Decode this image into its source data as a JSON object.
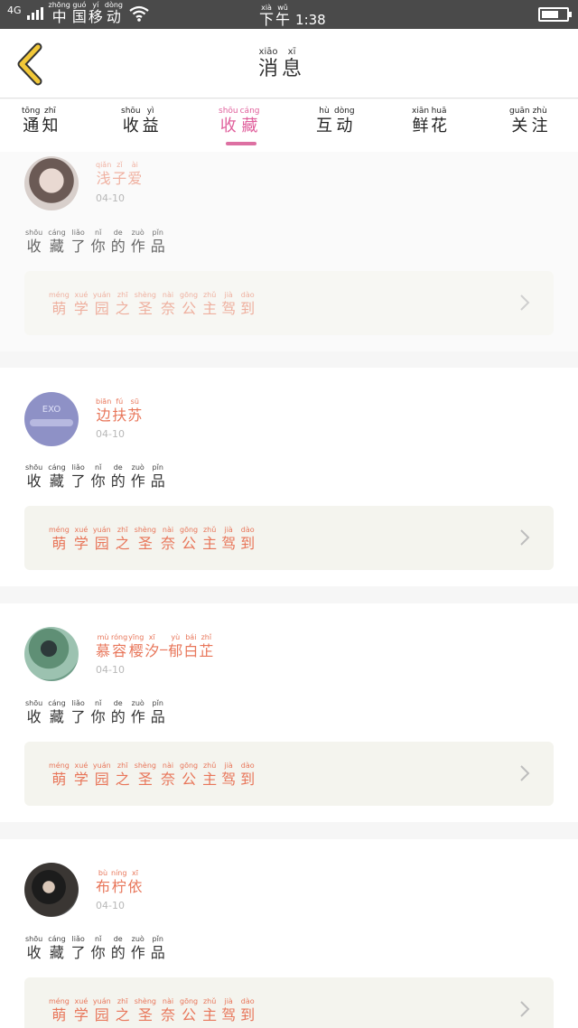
{
  "status_bar": {
    "network": "4G",
    "carrier": [
      {
        "py": "zhōng",
        "hz": "中"
      },
      {
        "py": "guó",
        "hz": "国"
      },
      {
        "py": "yí",
        "hz": "移"
      },
      {
        "py": "dòng",
        "hz": "动"
      }
    ],
    "time_prefix": [
      {
        "py": "xià",
        "hz": "下"
      },
      {
        "py": "wǔ",
        "hz": "午"
      }
    ],
    "time": "1:38",
    "battery_level": 0.7
  },
  "header": {
    "title": [
      {
        "py": "xiāo",
        "hz": "消"
      },
      {
        "py": "xī",
        "hz": "息"
      }
    ],
    "back_icon": "chevron-left-icon",
    "accent_color": "#f2c838"
  },
  "tabs": [
    {
      "chars": [
        {
          "py": "tōng",
          "hz": "通"
        },
        {
          "py": "zhī",
          "hz": "知"
        }
      ],
      "active": false
    },
    {
      "chars": [
        {
          "py": "shōu",
          "hz": "收"
        },
        {
          "py": "yì",
          "hz": "益"
        }
      ],
      "active": false
    },
    {
      "chars": [
        {
          "py": "shōu",
          "hz": "收"
        },
        {
          "py": "cáng",
          "hz": "藏"
        }
      ],
      "active": true
    },
    {
      "chars": [
        {
          "py": "hù",
          "hz": "互"
        },
        {
          "py": "dòng",
          "hz": "动"
        }
      ],
      "active": false
    },
    {
      "chars": [
        {
          "py": "xiān",
          "hz": "鲜"
        },
        {
          "py": "huā",
          "hz": "花"
        }
      ],
      "active": false
    },
    {
      "chars": [
        {
          "py": "guān",
          "hz": "关"
        },
        {
          "py": "zhù",
          "hz": "注"
        }
      ],
      "active": false
    }
  ],
  "tab_active_color": "#e0609c",
  "items": [
    {
      "user": [
        {
          "py": "qiǎn",
          "hz": "浅"
        },
        {
          "py": "zǐ",
          "hz": "子"
        },
        {
          "py": "ài",
          "hz": "爱"
        }
      ],
      "date": "04-10",
      "action": [
        {
          "py": "shōu",
          "hz": "收"
        },
        {
          "py": "cáng",
          "hz": "藏"
        },
        {
          "py": "liǎo",
          "hz": "了"
        },
        {
          "py": "nǐ",
          "hz": "你"
        },
        {
          "py": "de",
          "hz": "的"
        },
        {
          "py": "zuò",
          "hz": "作"
        },
        {
          "py": "pǐn",
          "hz": "品"
        }
      ],
      "work": [
        {
          "py": "méng",
          "hz": "萌"
        },
        {
          "py": "xué",
          "hz": "学"
        },
        {
          "py": "yuán",
          "hz": "园"
        },
        {
          "py": "zhī",
          "hz": "之"
        },
        {
          "py": "shèng",
          "hz": "圣"
        },
        {
          "py": "nài",
          "hz": "奈"
        },
        {
          "py": "gōng",
          "hz": "公"
        },
        {
          "py": "zhǔ",
          "hz": "主"
        },
        {
          "py": "jià",
          "hz": "驾"
        },
        {
          "py": "dào",
          "hz": "到"
        }
      ]
    },
    {
      "user": [
        {
          "py": "biān",
          "hz": "边"
        },
        {
          "py": "fú",
          "hz": "扶"
        },
        {
          "py": "sū",
          "hz": "苏"
        }
      ],
      "date": "04-10",
      "avatar_text": "EXO",
      "action": [
        {
          "py": "shōu",
          "hz": "收"
        },
        {
          "py": "cáng",
          "hz": "藏"
        },
        {
          "py": "liǎo",
          "hz": "了"
        },
        {
          "py": "nǐ",
          "hz": "你"
        },
        {
          "py": "de",
          "hz": "的"
        },
        {
          "py": "zuò",
          "hz": "作"
        },
        {
          "py": "pǐn",
          "hz": "品"
        }
      ],
      "work": [
        {
          "py": "méng",
          "hz": "萌"
        },
        {
          "py": "xué",
          "hz": "学"
        },
        {
          "py": "yuán",
          "hz": "园"
        },
        {
          "py": "zhī",
          "hz": "之"
        },
        {
          "py": "shèng",
          "hz": "圣"
        },
        {
          "py": "nài",
          "hz": "奈"
        },
        {
          "py": "gōng",
          "hz": "公"
        },
        {
          "py": "zhǔ",
          "hz": "主"
        },
        {
          "py": "jià",
          "hz": "驾"
        },
        {
          "py": "dào",
          "hz": "到"
        }
      ]
    },
    {
      "user": [
        {
          "py": "mù",
          "hz": "慕"
        },
        {
          "py": "róng",
          "hz": "容"
        },
        {
          "py": "yīng",
          "hz": "樱"
        },
        {
          "py": "xī",
          "hz": "汐"
        },
        {
          "py": "",
          "hz": "_"
        },
        {
          "py": "yù",
          "hz": "郁"
        },
        {
          "py": "bái",
          "hz": "白"
        },
        {
          "py": "zhǐ",
          "hz": "芷"
        }
      ],
      "date": "04-10",
      "action": [
        {
          "py": "shōu",
          "hz": "收"
        },
        {
          "py": "cáng",
          "hz": "藏"
        },
        {
          "py": "liǎo",
          "hz": "了"
        },
        {
          "py": "nǐ",
          "hz": "你"
        },
        {
          "py": "de",
          "hz": "的"
        },
        {
          "py": "zuò",
          "hz": "作"
        },
        {
          "py": "pǐn",
          "hz": "品"
        }
      ],
      "work": [
        {
          "py": "méng",
          "hz": "萌"
        },
        {
          "py": "xué",
          "hz": "学"
        },
        {
          "py": "yuán",
          "hz": "园"
        },
        {
          "py": "zhī",
          "hz": "之"
        },
        {
          "py": "shèng",
          "hz": "圣"
        },
        {
          "py": "nài",
          "hz": "奈"
        },
        {
          "py": "gōng",
          "hz": "公"
        },
        {
          "py": "zhǔ",
          "hz": "主"
        },
        {
          "py": "jià",
          "hz": "驾"
        },
        {
          "py": "dào",
          "hz": "到"
        }
      ]
    },
    {
      "user": [
        {
          "py": "bù",
          "hz": "布"
        },
        {
          "py": "níng",
          "hz": "柠"
        },
        {
          "py": "xī",
          "hz": "依"
        }
      ],
      "date": "04-10",
      "action": [
        {
          "py": "shōu",
          "hz": "收"
        },
        {
          "py": "cáng",
          "hz": "藏"
        },
        {
          "py": "liǎo",
          "hz": "了"
        },
        {
          "py": "nǐ",
          "hz": "你"
        },
        {
          "py": "de",
          "hz": "的"
        },
        {
          "py": "zuò",
          "hz": "作"
        },
        {
          "py": "pǐn",
          "hz": "品"
        }
      ],
      "work": [
        {
          "py": "méng",
          "hz": "萌"
        },
        {
          "py": "xué",
          "hz": "学"
        },
        {
          "py": "yuán",
          "hz": "园"
        },
        {
          "py": "zhī",
          "hz": "之"
        },
        {
          "py": "shèng",
          "hz": "圣"
        },
        {
          "py": "nài",
          "hz": "奈"
        },
        {
          "py": "gōng",
          "hz": "公"
        },
        {
          "py": "zhǔ",
          "hz": "主"
        },
        {
          "py": "jià",
          "hz": "驾"
        },
        {
          "py": "dào",
          "hz": "到"
        }
      ]
    }
  ],
  "icons": {
    "chevron": "chevron-right-icon",
    "wifi": "wifi-icon",
    "battery": "battery-icon",
    "signal": "signal-icon"
  }
}
